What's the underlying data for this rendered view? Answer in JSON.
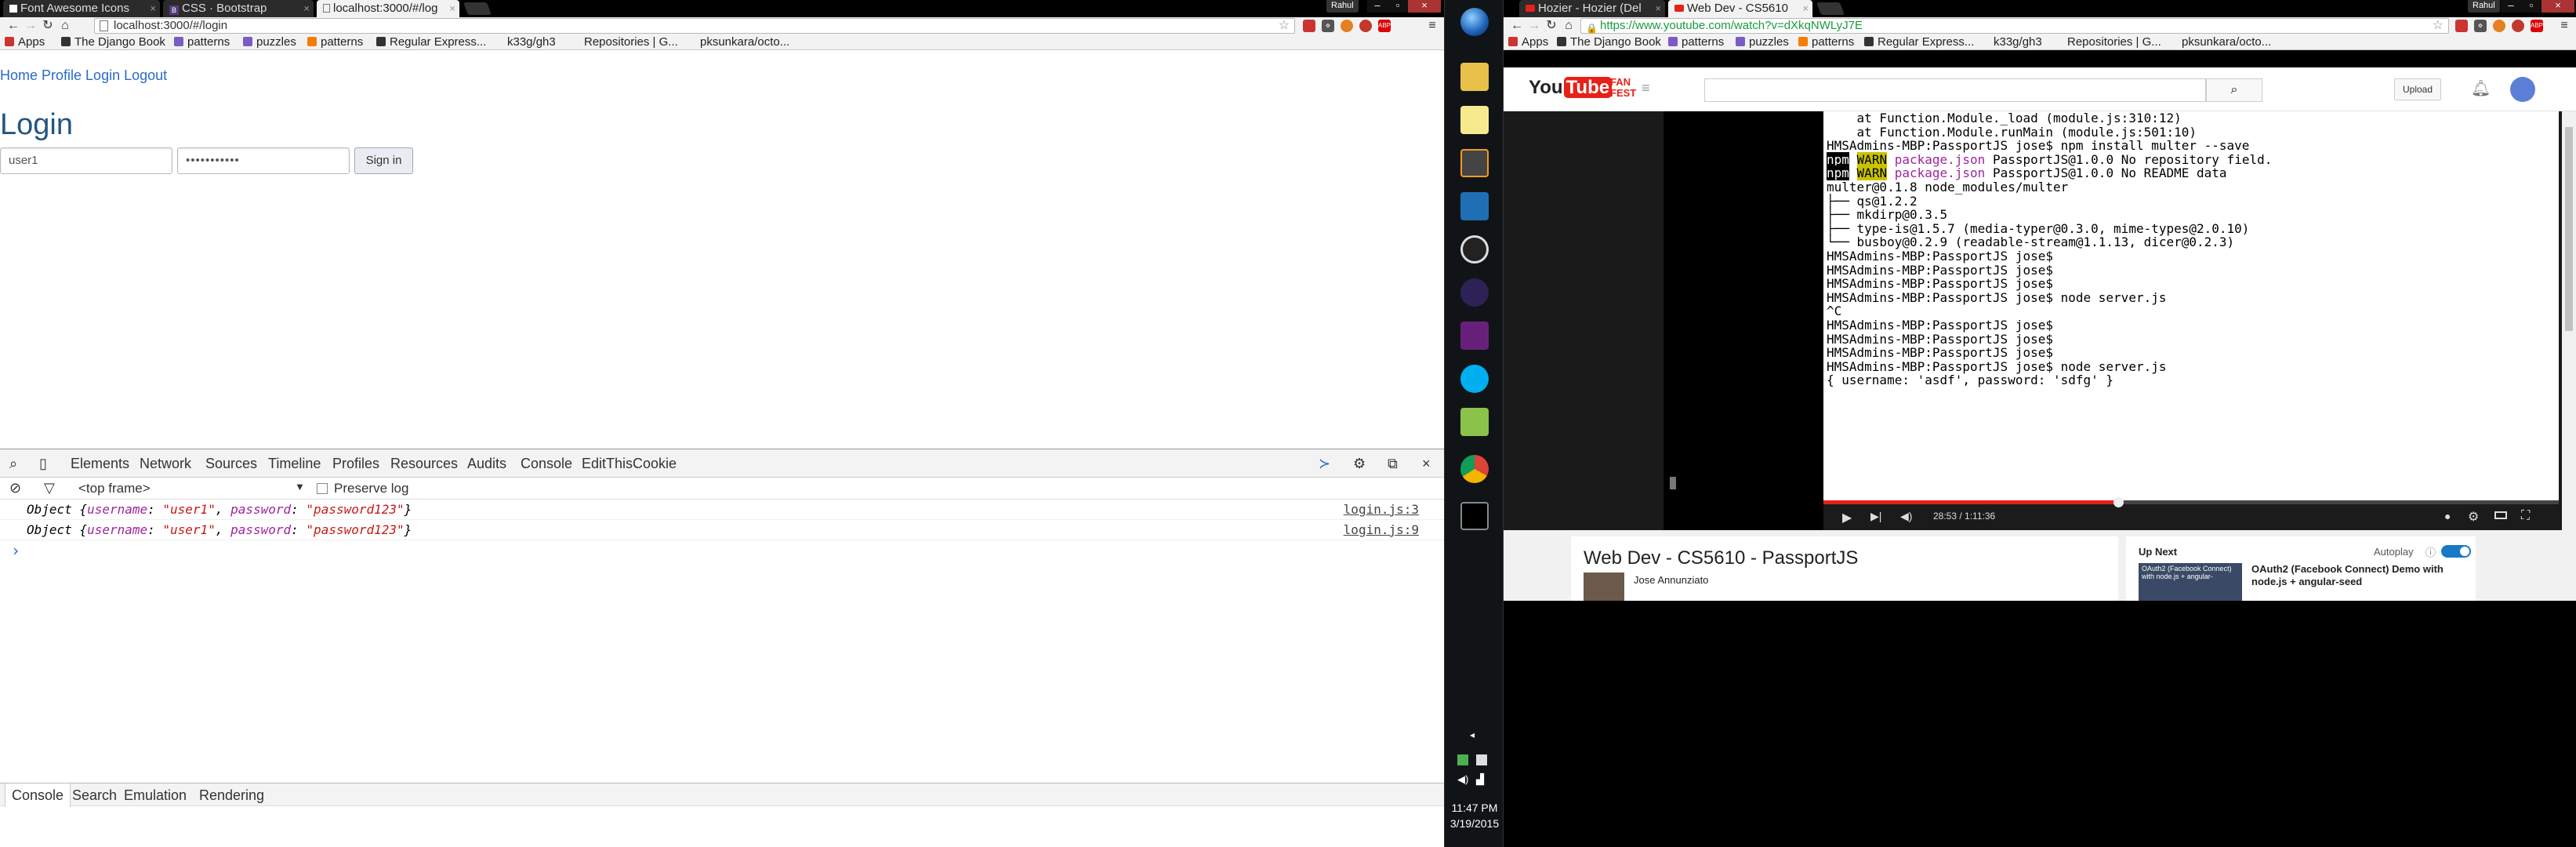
{
  "left_browser": {
    "tabs": [
      {
        "label": "Font Awesome Icons"
      },
      {
        "label": "CSS · Bootstrap"
      },
      {
        "label": "localhost:3000/#/log"
      }
    ],
    "profile": "Rahul",
    "url": "localhost:3000/#/login",
    "bookmarks": [
      "Apps",
      "The Django Book",
      "patterns",
      "puzzles",
      "patterns",
      "Regular Express...",
      "k33g/gh3",
      "Repositories | G...",
      "pksunkara/octo..."
    ],
    "page": {
      "nav": [
        "Home",
        "Profile",
        "Login",
        "Logout"
      ],
      "title": "Login",
      "username_value": "user1",
      "password_value": "•••••••••••",
      "signin_label": "Sign in"
    },
    "devtools": {
      "tabs": [
        "Elements",
        "Network",
        "Sources",
        "Timeline",
        "Profiles",
        "Resources",
        "Audits",
        "Console",
        "EditThisCookie"
      ],
      "frame": "<top frame>",
      "preserve_log": "Preserve log",
      "logs": [
        {
          "prefix": "Object {",
          "k1": "username",
          "v1": "\"user1\"",
          "k2": "password",
          "v2": "\"password123\"",
          "suffix": "}",
          "src": "login.js:3"
        },
        {
          "prefix": "Object {",
          "k1": "username",
          "v1": "\"user1\"",
          "k2": "password",
          "v2": "\"password123\"",
          "suffix": "}",
          "src": "login.js:9"
        }
      ],
      "prompt": "›",
      "drawer_tabs": [
        "Console",
        "Search",
        "Emulation",
        "Rendering"
      ]
    }
  },
  "taskbar": {
    "time": "11:47 PM",
    "date": "3/19/2015"
  },
  "right_browser": {
    "tabs": [
      {
        "label": "Hozier - Hozier (Del"
      },
      {
        "label": "Web Dev - CS5610"
      }
    ],
    "profile": "Rahul",
    "url": "https://www.youtube.com/watch?v=dXkqNWLyJ7E",
    "bookmarks": [
      "Apps",
      "The Django Book",
      "patterns",
      "puzzles",
      "patterns",
      "Regular Express...",
      "k33g/gh3",
      "Repositories | G...",
      "pksunkara/octo..."
    ],
    "youtube": {
      "logo": "You",
      "logo_tube": "Tube",
      "fanfest": "FAN FEST",
      "upload": "Upload",
      "time": "28:53 / 1:11:36",
      "video_title": "Web Dev - CS5610 - PassportJS",
      "channel": "Jose Annunziato",
      "up_next": "Up Next",
      "autoplay": "Autoplay",
      "next_title": "OAuth2 (Facebook Connect) Demo with node.js + angular-seed",
      "next_thumb_text": "OAuth2 (Facebook Connect) with node.js + angular-"
    },
    "terminal_lines": [
      "    at Function.Module._load (module.js:310:12)",
      "    at Function.Module.runMain (module.js:501:10)",
      "HMSAdmins-MBP:PassportJS jose$ npm install multer --save",
      "npm WARN package.json PassportJS@1.0.0 No repository field.",
      "npm WARN package.json PassportJS@1.0.0 No README data",
      "multer@0.1.8 node_modules/multer",
      "├── qs@1.2.2",
      "├── mkdirp@0.3.5",
      "├── type-is@1.5.7 (media-typer@0.3.0, mime-types@2.0.10)",
      "└── busboy@0.2.9 (readable-stream@1.1.13, dicer@0.2.3)",
      "HMSAdmins-MBP:PassportJS jose$",
      "HMSAdmins-MBP:PassportJS jose$",
      "HMSAdmins-MBP:PassportJS jose$",
      "HMSAdmins-MBP:PassportJS jose$ node server.js",
      "^C",
      "HMSAdmins-MBP:PassportJS jose$",
      "HMSAdmins-MBP:PassportJS jose$",
      "HMSAdmins-MBP:PassportJS jose$",
      "HMSAdmins-MBP:PassportJS jose$ node server.js",
      "{ username: 'asdf', password: 'sdfg' }"
    ]
  },
  "colors": {
    "link": "#2a6ac9",
    "title": "#245580",
    "yt_red": "#e62117",
    "taskbar": "#111417"
  }
}
